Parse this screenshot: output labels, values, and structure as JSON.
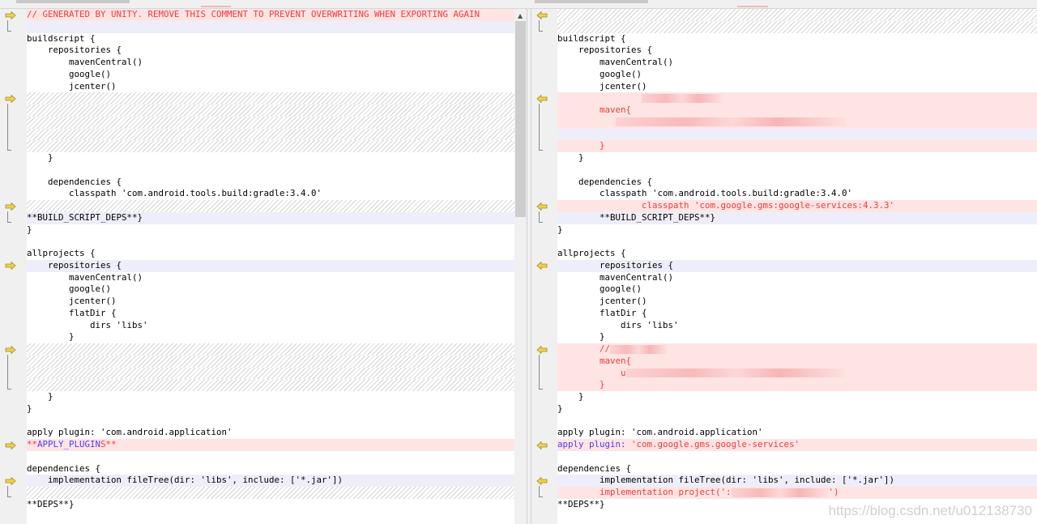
{
  "left": {
    "lines": [
      {
        "type": "added",
        "segs": [
          {
            "t": "// GENERATED BY UNITY. REMOVE THIS COMMENT TO PREVENT OVERWRITING WHEN EXPORTING AGAIN",
            "c": "red"
          }
        ]
      },
      {
        "type": "blank",
        "segs": []
      },
      {
        "type": "normal",
        "segs": [
          {
            "t": "buildscript {"
          }
        ]
      },
      {
        "type": "normal",
        "segs": [
          {
            "t": "    repositories {"
          }
        ]
      },
      {
        "type": "normal",
        "segs": [
          {
            "t": "        mavenCentral()"
          }
        ]
      },
      {
        "type": "normal",
        "segs": [
          {
            "t": "        google()"
          }
        ]
      },
      {
        "type": "normal",
        "segs": [
          {
            "t": "        jcenter()"
          }
        ]
      },
      {
        "type": "hatch",
        "segs": []
      },
      {
        "type": "hatch",
        "segs": []
      },
      {
        "type": "hatch",
        "segs": []
      },
      {
        "type": "hatch",
        "segs": []
      },
      {
        "type": "hatch",
        "segs": []
      },
      {
        "type": "normal",
        "segs": [
          {
            "t": "    }"
          }
        ]
      },
      {
        "type": "normal",
        "segs": []
      },
      {
        "type": "normal",
        "segs": [
          {
            "t": "    dependencies {"
          }
        ]
      },
      {
        "type": "normal",
        "segs": [
          {
            "t": "        classpath 'com.android.tools.build:gradle:3.4.0'"
          }
        ]
      },
      {
        "type": "hatch",
        "segs": []
      },
      {
        "type": "blank",
        "segs": [
          {
            "t": "**BUILD_SCRIPT_DEPS**}"
          }
        ]
      },
      {
        "type": "normal",
        "segs": [
          {
            "t": "}"
          }
        ]
      },
      {
        "type": "normal",
        "segs": []
      },
      {
        "type": "normal",
        "segs": [
          {
            "t": "allprojects {"
          }
        ]
      },
      {
        "type": "blank",
        "segs": [
          {
            "t": "    repositories {"
          }
        ]
      },
      {
        "type": "normal",
        "segs": [
          {
            "t": "        mavenCentral()"
          }
        ]
      },
      {
        "type": "normal",
        "segs": [
          {
            "t": "        google()"
          }
        ]
      },
      {
        "type": "normal",
        "segs": [
          {
            "t": "        jcenter()"
          }
        ]
      },
      {
        "type": "normal",
        "segs": [
          {
            "t": "        flatDir {"
          }
        ]
      },
      {
        "type": "normal",
        "segs": [
          {
            "t": "            dirs 'libs'"
          }
        ]
      },
      {
        "type": "normal",
        "segs": [
          {
            "t": "        }"
          }
        ]
      },
      {
        "type": "hatch",
        "segs": []
      },
      {
        "type": "hatch",
        "segs": []
      },
      {
        "type": "hatch",
        "segs": []
      },
      {
        "type": "hatch",
        "segs": []
      },
      {
        "type": "normal",
        "segs": [
          {
            "t": "    }"
          }
        ]
      },
      {
        "type": "normal",
        "segs": [
          {
            "t": "}"
          }
        ]
      },
      {
        "type": "normal",
        "segs": []
      },
      {
        "type": "normal",
        "segs": [
          {
            "t": "apply plugin: 'com.android.application'"
          }
        ]
      },
      {
        "type": "added",
        "segs": [
          {
            "t": "**",
            "c": "red"
          },
          {
            "t": "APPLY_PLUGIN",
            "c": "blue"
          },
          {
            "t": "S**",
            "c": "red"
          }
        ]
      },
      {
        "type": "normal",
        "segs": []
      },
      {
        "type": "normal",
        "segs": [
          {
            "t": "dependencies {"
          }
        ]
      },
      {
        "type": "blank",
        "segs": [
          {
            "t": "    implementation fileTree(dir: 'libs', include: ['*.jar'])"
          }
        ]
      },
      {
        "type": "hatch",
        "segs": []
      },
      {
        "type": "normal",
        "segs": [
          {
            "t": "**DEPS**}"
          }
        ]
      }
    ],
    "blocks": [
      [
        0,
        2
      ],
      [
        7,
        5
      ],
      [
        16,
        2
      ],
      [
        21,
        1
      ],
      [
        28,
        4
      ],
      [
        36,
        1
      ],
      [
        39,
        2
      ]
    ]
  },
  "right": {
    "lines": [
      {
        "type": "hatch",
        "segs": []
      },
      {
        "type": "hatch",
        "segs": []
      },
      {
        "type": "normal",
        "segs": [
          {
            "t": "buildscript {"
          }
        ]
      },
      {
        "type": "normal",
        "segs": [
          {
            "t": "    repositories {"
          }
        ]
      },
      {
        "type": "normal",
        "segs": [
          {
            "t": "        mavenCentral()"
          }
        ]
      },
      {
        "type": "normal",
        "segs": [
          {
            "t": "        google()"
          }
        ]
      },
      {
        "type": "normal",
        "segs": [
          {
            "t": "        jcenter()"
          }
        ]
      },
      {
        "type": "added",
        "segs": [
          {
            "t": "                "
          },
          {
            "blur": 100
          }
        ]
      },
      {
        "type": "added",
        "segs": [
          {
            "t": "        maven{",
            "c": "red"
          }
        ]
      },
      {
        "type": "added",
        "segs": [
          {
            "t": "           "
          },
          {
            "blur": 285
          }
        ]
      },
      {
        "type": "blank",
        "segs": []
      },
      {
        "type": "added",
        "segs": [
          {
            "t": "        }",
            "c": "red"
          }
        ]
      },
      {
        "type": "normal",
        "segs": [
          {
            "t": "    }"
          }
        ]
      },
      {
        "type": "normal",
        "segs": []
      },
      {
        "type": "normal",
        "segs": [
          {
            "t": "    dependencies {"
          }
        ]
      },
      {
        "type": "normal",
        "segs": [
          {
            "t": "        classpath 'com.android.tools.build:gradle:3.4.0'"
          }
        ]
      },
      {
        "type": "added",
        "segs": [
          {
            "t": "                classpath 'com.google.gms:google-services:4.3.3'",
            "c": "red"
          }
        ]
      },
      {
        "type": "blank",
        "segs": [
          {
            "t": "        **BUILD_SCRIPT_DEPS**}"
          }
        ]
      },
      {
        "type": "normal",
        "segs": [
          {
            "t": "}"
          }
        ]
      },
      {
        "type": "normal",
        "segs": []
      },
      {
        "type": "normal",
        "segs": [
          {
            "t": "allprojects {"
          }
        ]
      },
      {
        "type": "blank",
        "segs": [
          {
            "t": "        repositories {"
          }
        ]
      },
      {
        "type": "normal",
        "segs": [
          {
            "t": "        mavenCentral()"
          }
        ]
      },
      {
        "type": "normal",
        "segs": [
          {
            "t": "        google()"
          }
        ]
      },
      {
        "type": "normal",
        "segs": [
          {
            "t": "        jcenter()"
          }
        ]
      },
      {
        "type": "normal",
        "segs": [
          {
            "t": "        flatDir {"
          }
        ]
      },
      {
        "type": "normal",
        "segs": [
          {
            "t": "            dirs 'libs'"
          }
        ]
      },
      {
        "type": "normal",
        "segs": [
          {
            "t": "        }"
          }
        ]
      },
      {
        "type": "added",
        "segs": [
          {
            "t": "        //",
            "c": "red"
          },
          {
            "blur": 70
          }
        ]
      },
      {
        "type": "added",
        "segs": [
          {
            "t": "        maven{",
            "c": "red"
          }
        ]
      },
      {
        "type": "added",
        "segs": [
          {
            "t": "            u",
            "c": "red"
          },
          {
            "blur": 270
          }
        ]
      },
      {
        "type": "added",
        "segs": [
          {
            "t": "        }",
            "c": "red"
          }
        ]
      },
      {
        "type": "normal",
        "segs": [
          {
            "t": "    }"
          }
        ]
      },
      {
        "type": "normal",
        "segs": [
          {
            "t": "}"
          }
        ]
      },
      {
        "type": "normal",
        "segs": []
      },
      {
        "type": "normal",
        "segs": [
          {
            "t": "apply plugin: 'com.android.application'"
          }
        ]
      },
      {
        "type": "added",
        "segs": [
          {
            "t": "apply plugin: ",
            "c": "blue"
          },
          {
            "t": "'com.google.gms.google-services'",
            "c": "red"
          }
        ]
      },
      {
        "type": "normal",
        "segs": []
      },
      {
        "type": "normal",
        "segs": [
          {
            "t": "dependencies {"
          }
        ]
      },
      {
        "type": "blank",
        "segs": [
          {
            "t": "        implementation fileTree(dir: 'libs', include: ['*.jar'])"
          }
        ]
      },
      {
        "type": "added",
        "segs": [
          {
            "t": "        implementation project(':",
            "c": "red"
          },
          {
            "blur": 120
          },
          {
            "t": "')",
            "c": "red"
          }
        ]
      },
      {
        "type": "normal",
        "segs": [
          {
            "t": "**DEPS**}"
          }
        ]
      }
    ],
    "blocks": [
      [
        0,
        2
      ],
      [
        7,
        5
      ],
      [
        16,
        2
      ],
      [
        21,
        1
      ],
      [
        28,
        4
      ],
      [
        36,
        1
      ],
      [
        39,
        2
      ]
    ]
  },
  "watermark": "https://blog.csdn.net/u012138730",
  "colors": {
    "added_bg": "#ffe4e4",
    "blank_bg": "#eeeefa",
    "red": "#f03a3a",
    "blue": "#4b3cf0",
    "arrow": "#f2d24a"
  }
}
